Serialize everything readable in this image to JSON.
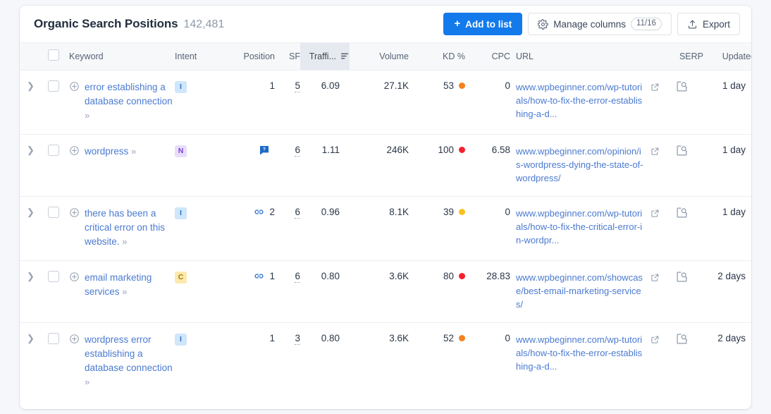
{
  "header": {
    "title": "Organic Search Positions",
    "count": "142,481",
    "add_to_list_label": "Add to list",
    "add_to_list_plus": "+",
    "manage_columns_label": "Manage columns",
    "manage_columns_badge": "11/16",
    "export_label": "Export"
  },
  "columns": {
    "keyword": "Keyword",
    "intent": "Intent",
    "position": "Position",
    "sf": "SF",
    "traffic": "Traffi...",
    "volume": "Volume",
    "kd": "KD %",
    "cpc": "CPC",
    "url": "URL",
    "serp": "SERP",
    "updated": "Updated"
  },
  "colors": {
    "primary": "#137aeb",
    "link": "#4b7bd1",
    "kd_orange": "#f58220",
    "kd_red": "#f4212e",
    "kd_yellow": "#fbc01e",
    "sorted_header_bg": "#e6e9ef"
  },
  "rows": [
    {
      "keyword": "error establishing a database connection",
      "intent": "I",
      "position": "1",
      "position_icon": "",
      "sf": "5",
      "traffic": "6.09",
      "volume": "27.1K",
      "kd": "53",
      "kd_color": "#f58220",
      "cpc": "0",
      "url": "www.wpbeginner.com/wp-tutorials/how-to-fix-the-error-establishing-a-d...",
      "updated": "1 day"
    },
    {
      "keyword": "wordpress",
      "intent": "N",
      "position": "",
      "position_icon": "faq-bubble",
      "sf": "6",
      "traffic": "1.11",
      "volume": "246K",
      "kd": "100",
      "kd_color": "#f4212e",
      "cpc": "6.58",
      "url": "www.wpbeginner.com/opinion/is-wordpress-dying-the-state-of-wordpress/",
      "updated": "1 day"
    },
    {
      "keyword": "there has been a critical error on this website.",
      "intent": "I",
      "position": "2",
      "position_icon": "link-chain",
      "sf": "6",
      "traffic": "0.96",
      "volume": "8.1K",
      "kd": "39",
      "kd_color": "#fbc01e",
      "cpc": "0",
      "url": "www.wpbeginner.com/wp-tutorials/how-to-fix-the-critical-error-in-wordpr...",
      "updated": "1 day"
    },
    {
      "keyword": "email marketing services",
      "intent": "C",
      "position": "1",
      "position_icon": "link-chain",
      "sf": "6",
      "traffic": "0.80",
      "volume": "3.6K",
      "kd": "80",
      "kd_color": "#f4212e",
      "cpc": "28.83",
      "url": "www.wpbeginner.com/showcase/best-email-marketing-services/",
      "updated": "2 days"
    },
    {
      "keyword": "wordpress error establishing a database connection",
      "intent": "I",
      "position": "1",
      "position_icon": "",
      "sf": "3",
      "traffic": "0.80",
      "volume": "3.6K",
      "kd": "52",
      "kd_color": "#f58220",
      "cpc": "0",
      "url": "www.wpbeginner.com/wp-tutorials/how-to-fix-the-error-establishing-a-d...",
      "updated": "2 days"
    }
  ],
  "row_controls": {
    "expand_chevron": "❯",
    "keyword_more": "»"
  }
}
